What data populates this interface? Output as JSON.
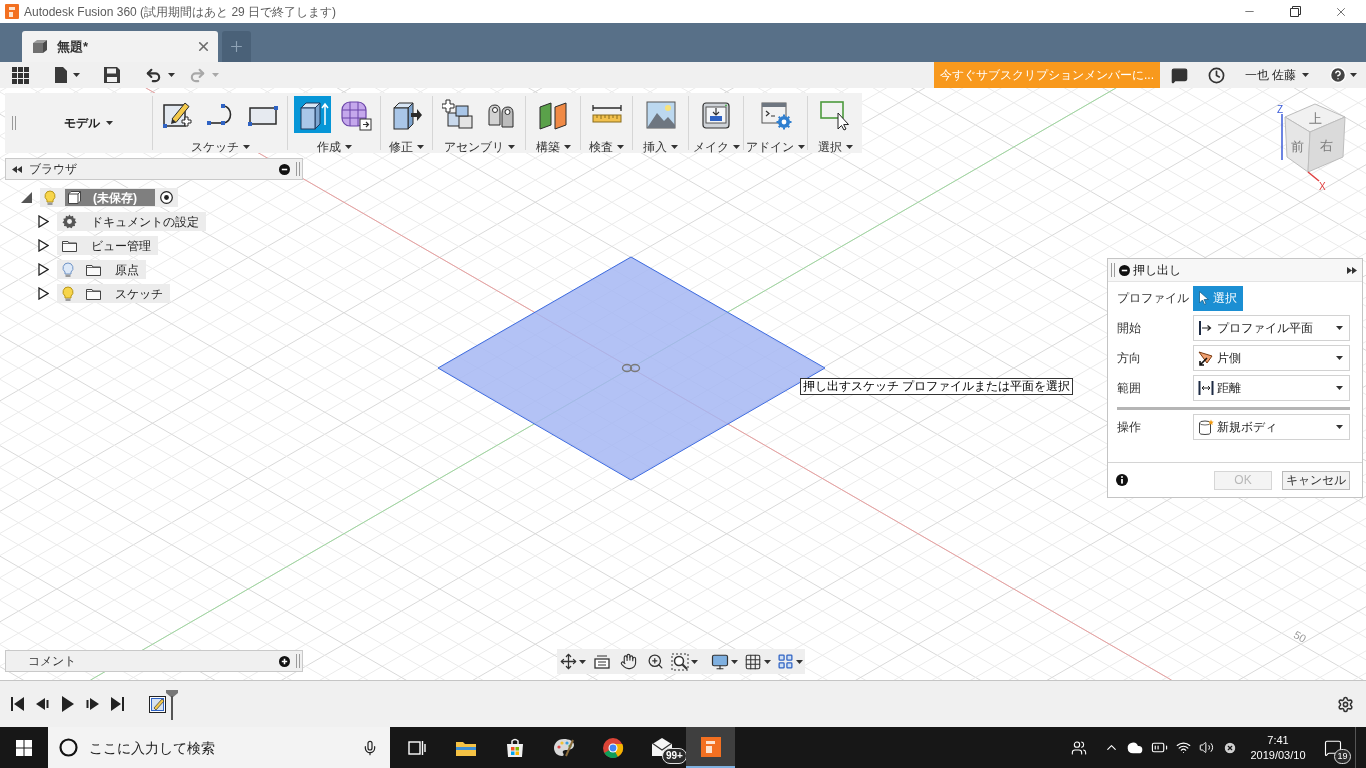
{
  "window": {
    "title": "Autodesk Fusion 360 (試用期間はあと 29 日で終了します)"
  },
  "tabs": [
    {
      "label": "無題*",
      "selected": true
    }
  ],
  "quick_access": {
    "subscribe_button": "今すぐサブスクリプションメンバーに...",
    "user": "一也 佐藤"
  },
  "toolbar": {
    "workspace": "モデル",
    "groups": [
      {
        "label": "スケッチ",
        "tools": [
          {
            "selected": false
          },
          {
            "selected": false
          },
          {
            "selected": false
          }
        ]
      },
      {
        "label": "作成",
        "tools": [
          {
            "selected": true
          },
          {
            "selected": false
          }
        ]
      },
      {
        "label": "修正",
        "tools": [
          {
            "selected": false
          }
        ]
      },
      {
        "label": "アセンブリ",
        "tools": [
          {
            "selected": false
          },
          {
            "selected": false
          }
        ]
      },
      {
        "label": "構築",
        "tools": [
          {
            "selected": false
          }
        ]
      },
      {
        "label": "検査",
        "tools": [
          {
            "selected": false
          }
        ]
      },
      {
        "label": "挿入",
        "tools": [
          {
            "selected": false
          }
        ]
      },
      {
        "label": "メイク",
        "tools": [
          {
            "selected": false
          }
        ]
      },
      {
        "label": "アドイン",
        "tools": [
          {
            "selected": false
          }
        ]
      },
      {
        "label": "選択",
        "tools": [
          {
            "selected": false
          }
        ]
      }
    ]
  },
  "browser": {
    "title": "ブラウザ",
    "root": {
      "label": "(未保存)",
      "expanded": true,
      "visible": true,
      "children": [
        {
          "kind": "settings",
          "label": "ドキュメントの設定",
          "expanded": false
        },
        {
          "kind": "folder",
          "label": "ビュー管理",
          "expanded": false
        },
        {
          "kind": "folder",
          "label": "原点",
          "expanded": false,
          "visible": false
        },
        {
          "kind": "folder",
          "label": "スケッチ",
          "expanded": false,
          "visible": true
        }
      ]
    }
  },
  "canvas": {
    "axis_label": "50",
    "tooltip": "押し出すスケッチ プロファイルまたは平面を選択",
    "view_cube": {
      "top": "上",
      "front": "前",
      "right": "右",
      "axis_z": "Z",
      "axis_x": "X"
    }
  },
  "extrude_dialog": {
    "title": "押し出し",
    "sections": [
      {
        "rows": [
          {
            "kind": "select",
            "label": "プロファイル",
            "value": "選択"
          },
          {
            "kind": "dropdown",
            "label": "開始",
            "value": "プロファイル平面"
          },
          {
            "kind": "dropdown",
            "label": "方向",
            "value": "片側"
          },
          {
            "kind": "dropdown",
            "label": "範囲",
            "value": "距離"
          }
        ]
      },
      {
        "rows": [
          {
            "kind": "dropdown",
            "label": "操作",
            "value": "新規ボディ"
          }
        ]
      }
    ],
    "ok": {
      "label": "OK",
      "disabled": true
    },
    "cancel": {
      "label": "キャンセル"
    }
  },
  "comments": {
    "title": "コメント"
  },
  "taskbar": {
    "search": {
      "placeholder": "ここに入力して検索"
    },
    "apps": [
      {
        "selected": false
      },
      {
        "selected": false
      },
      {
        "selected": false
      },
      {
        "selected": false
      },
      {
        "selected": false,
        "badge": "99+"
      },
      {
        "selected": true
      }
    ],
    "time": "7:41",
    "date": "2019/03/10",
    "notifications": "19"
  }
}
